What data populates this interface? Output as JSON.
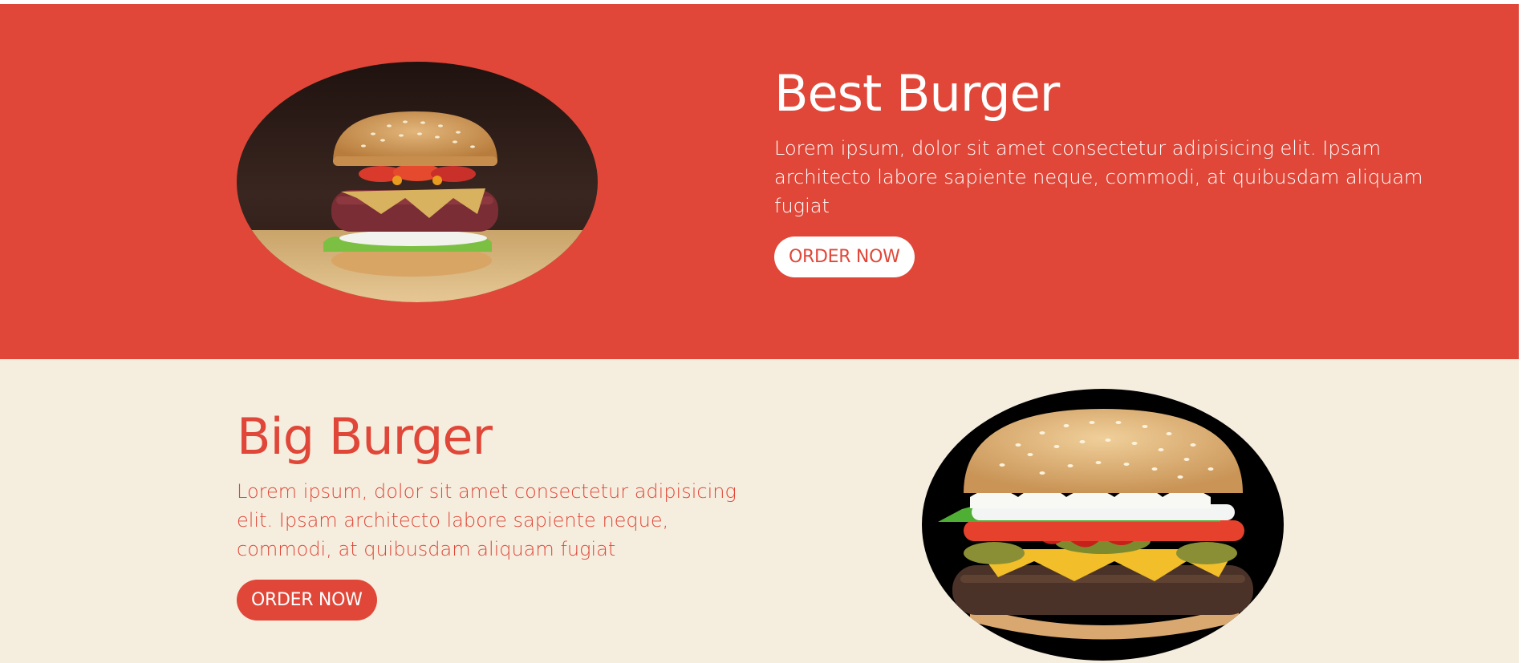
{
  "colors": {
    "accent_red": "#e04738",
    "cream": "#f5eedf",
    "white": "#ffffff"
  },
  "products": [
    {
      "title": "Best Burger",
      "description": "Lorem ipsum, dolor sit amet consectetur adipisicing elit. Ipsam architecto labore sapiente neque, commodi, at quibusdam aliquam fugiat",
      "button_label": "ORDER NOW"
    },
    {
      "title": "Big Burger",
      "description": "Lorem ipsum, dolor sit amet consectetur adipisicing elit. Ipsam architecto labore sapiente neque, commodi, at quibusdam aliquam fugiat",
      "button_label": "ORDER NOW"
    }
  ]
}
